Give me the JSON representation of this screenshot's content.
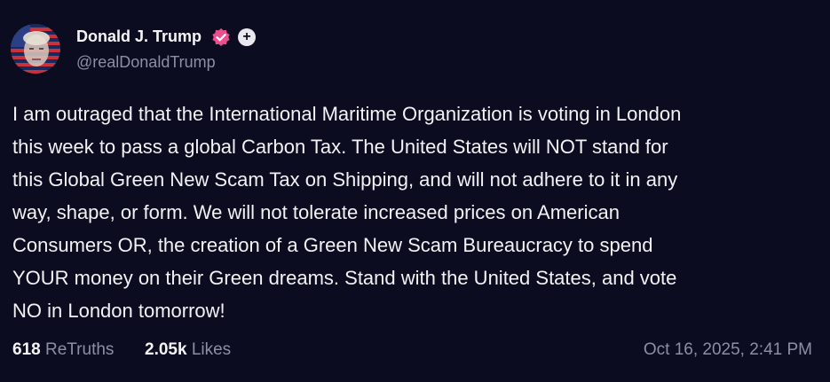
{
  "author": {
    "display_name": "Donald J. Trump",
    "handle": "@realDonaldTrump",
    "verified_icon": "verified-check-icon",
    "follow_icon": "plus-icon",
    "follow_label": "+"
  },
  "post": {
    "lines": [
      "I am outraged that the International Maritime Organization is voting in London",
      "this week to pass a global Carbon Tax. The United States will NOT stand for",
      "this Global Green New Scam Tax on Shipping, and will not adhere to it in any",
      "way, shape, or form. We will not tolerate increased prices on American",
      "Consumers OR, the creation of a Green New Scam Bureaucracy to spend",
      "YOUR money on their Green dreams. Stand with the United States, and vote",
      "NO in London tomorrow!"
    ]
  },
  "stats": {
    "retruths_count": "618",
    "retruths_label": "ReTruths",
    "likes_count": "2.05k",
    "likes_label": "Likes"
  },
  "timestamp": "Oct 16, 2025, 2:41 PM",
  "colors": {
    "background": "#0c0c21",
    "text": "#f2f2f5",
    "muted": "#8d8da6",
    "verified": "#e94e8f"
  }
}
